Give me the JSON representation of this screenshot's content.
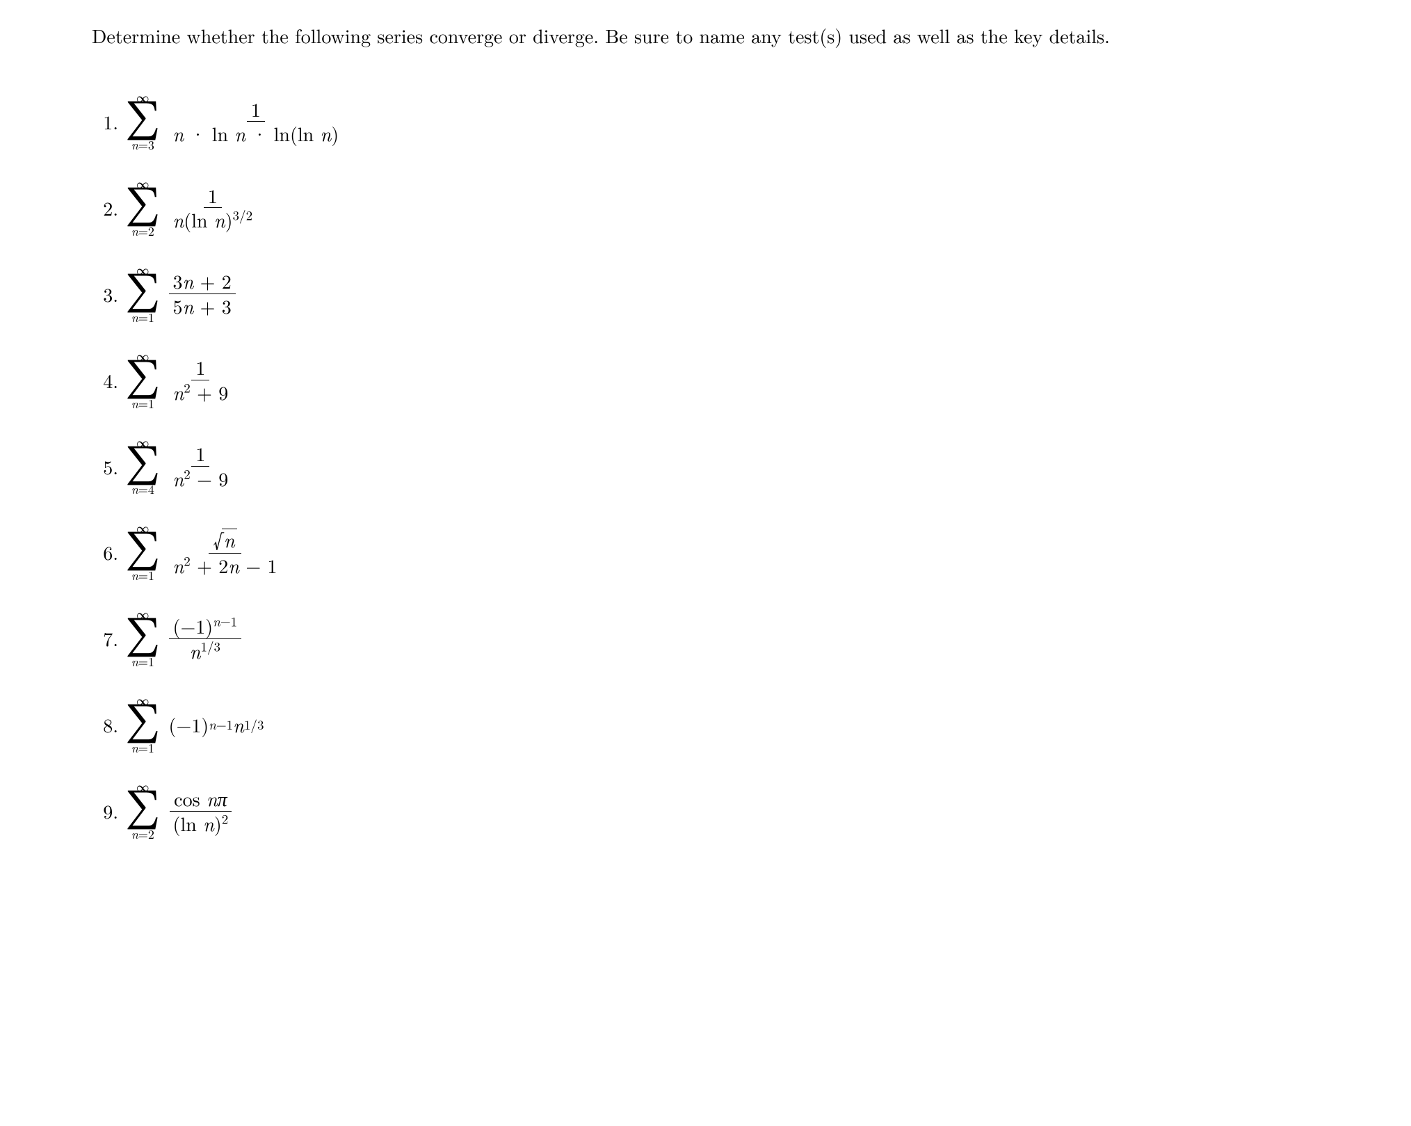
{
  "instructions": "Determine whether the following series converge or diverge. Be sure to name any test(s) used as well as the key details.",
  "sigma": {
    "symbol": "∑",
    "top": "∞"
  },
  "problems": [
    {
      "number": "1.",
      "lower_n": "n",
      "lower_eq": "=3",
      "num": "1",
      "den_html": "<span class='it'>n</span> · ln <span class='it'>n</span> · ln(ln <span class='it'>n</span>)"
    },
    {
      "number": "2.",
      "lower_n": "n",
      "lower_eq": "=2",
      "num": "1",
      "den_html": "<span class='it'>n</span>(ln <span class='it'>n</span>)<sup>3/2</sup>"
    },
    {
      "number": "3.",
      "lower_n": "n",
      "lower_eq": "=1",
      "num_html": "3<span class='it'>n</span> + 2",
      "den_html": "5<span class='it'>n</span> + 3"
    },
    {
      "number": "4.",
      "lower_n": "n",
      "lower_eq": "=1",
      "num": "1",
      "den_html": "<span class='it'>n</span><sup>2</sup> + 9"
    },
    {
      "number": "5.",
      "lower_n": "n",
      "lower_eq": "=4",
      "num": "1",
      "den_html": "<span class='it'>n</span><sup>2</sup> − 9"
    },
    {
      "number": "6.",
      "lower_n": "n",
      "lower_eq": "=1",
      "num_html": "<span class='sqrt'><span class='sqrt-sym'>√</span><span class='sqrt-body'><span class='it'>n</span></span></span>",
      "den_html": "<span class='it'>n</span><sup>2</sup> + 2<span class='it'>n</span> − 1"
    },
    {
      "number": "7.",
      "lower_n": "n",
      "lower_eq": "=1",
      "num_html": "(−1)<sup><span class='it'>n</span>−1</sup>",
      "den_html": "<span class='it'>n</span><sup>1/3</sup>"
    },
    {
      "number": "8.",
      "lower_n": "n",
      "lower_eq": "=1",
      "inline_html": "(−1)<sup><span class='it'>n</span>−1</sup><span class='it'>n</span><sup>1/3</sup>"
    },
    {
      "number": "9.",
      "lower_n": "n",
      "lower_eq": "=2",
      "num_html": "cos <span class='it'>nπ</span>",
      "den_html": "(ln <span class='it'>n</span>)<sup>2</sup>"
    }
  ]
}
